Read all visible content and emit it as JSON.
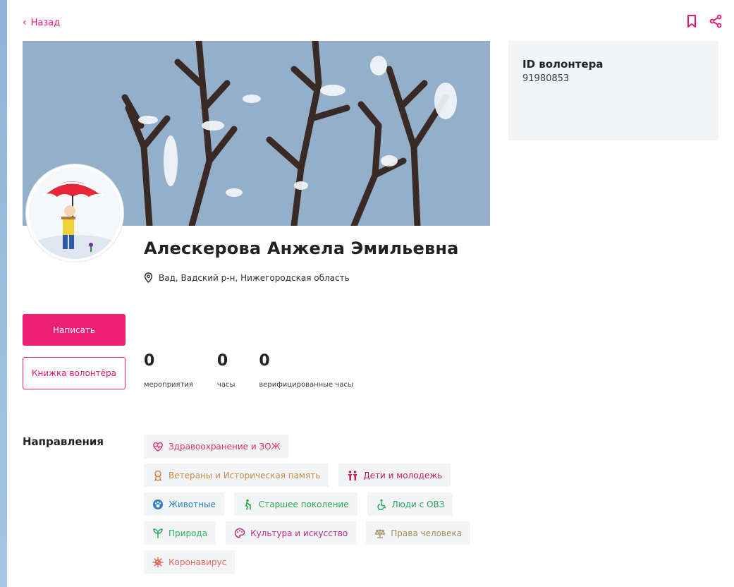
{
  "nav": {
    "back_label": "Назад"
  },
  "profile": {
    "name": "Алескерова Анжела Эмильевна",
    "location": "Вад, Вадский р-н, Нижегородская область"
  },
  "actions": {
    "write_label": "Написать",
    "book_label": "Книжка волонтёра"
  },
  "stats": [
    {
      "value": "0",
      "label": "мероприятия"
    },
    {
      "value": "0",
      "label": "часы"
    },
    {
      "value": "0",
      "label": "верифицированные часы"
    }
  ],
  "id_card": {
    "title": "ID волонтера",
    "value": "91980853"
  },
  "directions": {
    "title": "Направления",
    "tags": [
      {
        "label": "Здравоохранение и ЗОЖ",
        "icon": "heart-pulse-icon",
        "color": "#e0356d"
      },
      {
        "label": "Ветераны и Историческая память",
        "icon": "medal-icon",
        "color": "#c98a4a"
      },
      {
        "label": "Дети и молодежь",
        "icon": "children-icon",
        "color": "#c1224f"
      },
      {
        "label": "Животные",
        "icon": "paw-icon",
        "color": "#2d7fc8"
      },
      {
        "label": "Старшее поколение",
        "icon": "elderly-icon",
        "color": "#2ea84a"
      },
      {
        "label": "Люди с ОВЗ",
        "icon": "wheelchair-icon",
        "color": "#2aa85e"
      },
      {
        "label": "Природа",
        "icon": "sprout-icon",
        "color": "#2eb062"
      },
      {
        "label": "Культура и искусство",
        "icon": "palette-icon",
        "color": "#c02a88"
      },
      {
        "label": "Права человека",
        "icon": "scales-icon",
        "color": "#a08c58"
      },
      {
        "label": "Коронавирус",
        "icon": "virus-icon",
        "color": "#e36a5a"
      }
    ]
  },
  "colors": {
    "accent": "#ec1f72"
  }
}
